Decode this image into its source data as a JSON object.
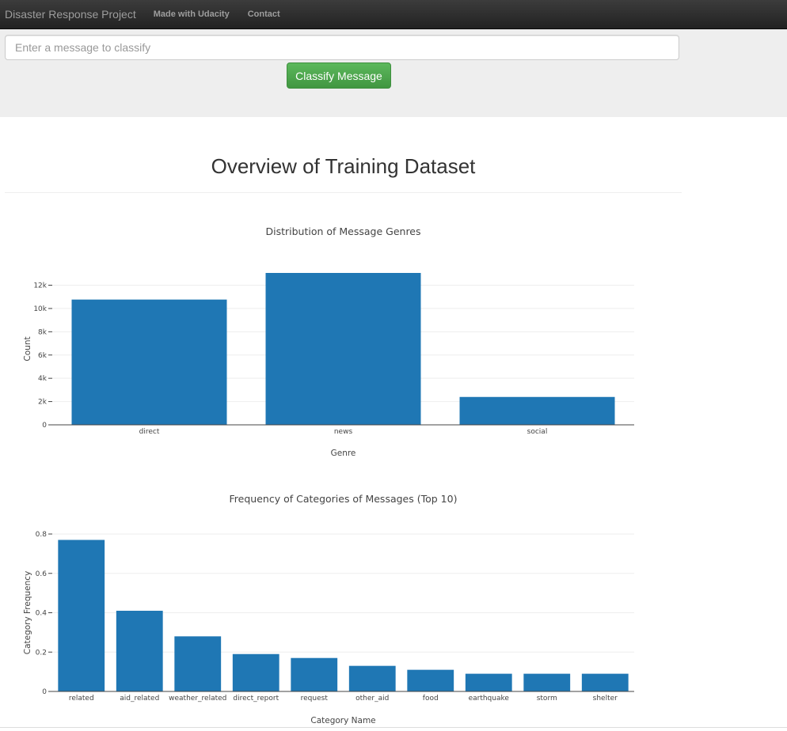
{
  "navbar": {
    "brand": "Disaster Response Project",
    "links": [
      "Made with Udacity",
      "Contact"
    ]
  },
  "form": {
    "placeholder": "Enter a message to classify",
    "button_label": "Classify Message"
  },
  "page_title": "Overview of Training Dataset",
  "colors": {
    "bar": "#1f77b4",
    "button": "#5cb85c",
    "navbar": "#222222"
  },
  "chart_data": [
    {
      "type": "bar",
      "title": "Distribution of Message Genres",
      "xlabel": "Genre",
      "ylabel": "Count",
      "categories": [
        "direct",
        "news",
        "social"
      ],
      "values": [
        10766,
        13054,
        2396
      ],
      "ylim": [
        0,
        13054
      ],
      "yticks": [
        0,
        2000,
        4000,
        6000,
        8000,
        10000,
        12000
      ],
      "ytick_labels": [
        "0",
        "2k",
        "4k",
        "6k",
        "8k",
        "10k",
        "12k"
      ],
      "grid": true
    },
    {
      "type": "bar",
      "title": "Frequency of Categories of Messages (Top 10)",
      "xlabel": "Category Name",
      "ylabel": "Category Frequency",
      "categories": [
        "related",
        "aid_related",
        "weather_related",
        "direct_report",
        "request",
        "other_aid",
        "food",
        "earthquake",
        "storm",
        "shelter"
      ],
      "values": [
        0.77,
        0.41,
        0.28,
        0.19,
        0.17,
        0.13,
        0.11,
        0.09,
        0.09,
        0.09
      ],
      "ylim": [
        0,
        0.8
      ],
      "yticks": [
        0,
        0.2,
        0.4,
        0.6,
        0.8
      ],
      "ytick_labels": [
        "0",
        "0.2",
        "0.4",
        "0.6",
        "0.8"
      ],
      "grid": true
    }
  ]
}
